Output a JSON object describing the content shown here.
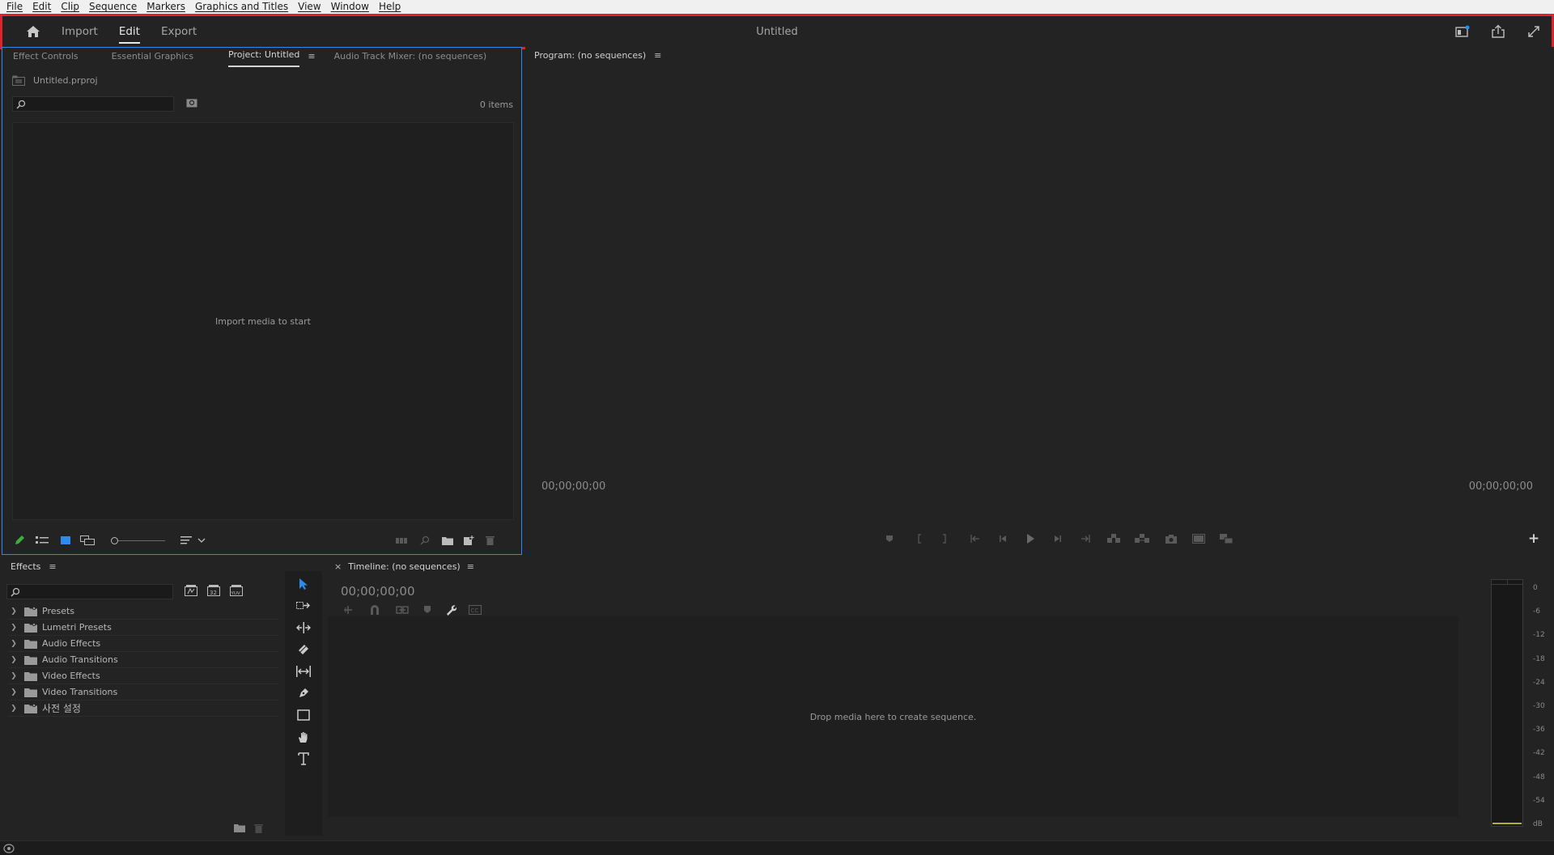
{
  "menu": {
    "items": [
      "File",
      "Edit",
      "Clip",
      "Sequence",
      "Markers",
      "Graphics and Titles",
      "View",
      "Window",
      "Help"
    ]
  },
  "header": {
    "tabs": [
      {
        "label": "Import",
        "active": false
      },
      {
        "label": "Edit",
        "active": true
      },
      {
        "label": "Export",
        "active": false
      }
    ],
    "title": "Untitled",
    "highlight_color": "#e0232b"
  },
  "project_panel": {
    "tabs": [
      "Effect Controls",
      "Essential Graphics",
      "Project: Untitled",
      "Audio Track Mixer: (no sequences)"
    ],
    "active_tab": "Project: Untitled",
    "file_name": "Untitled.prproj",
    "search_placeholder": "",
    "items_count": "0 items",
    "empty_message": "Import media to start",
    "focus_color": "#2d8ceb"
  },
  "program_monitor": {
    "tab": "Program: (no sequences)",
    "timecode_left": "00;00;00;00",
    "timecode_right": "00;00;00;00",
    "add_button": "+"
  },
  "effects_panel": {
    "tab": "Effects",
    "items": [
      "Presets",
      "Lumetri Presets",
      "Audio Effects",
      "Audio Transitions",
      "Video Effects",
      "Video Transitions",
      "사전 설정"
    ]
  },
  "timeline": {
    "tab": "Timeline: (no sequences)",
    "close": "×",
    "timecode": "00;00;00;00",
    "empty_message": "Drop media here to create sequence."
  },
  "audio_meter": {
    "labels": [
      "0",
      "-6",
      "-12",
      "-18",
      "-24",
      "-30",
      "-36",
      "-42",
      "-48",
      "-54",
      "dB"
    ]
  }
}
